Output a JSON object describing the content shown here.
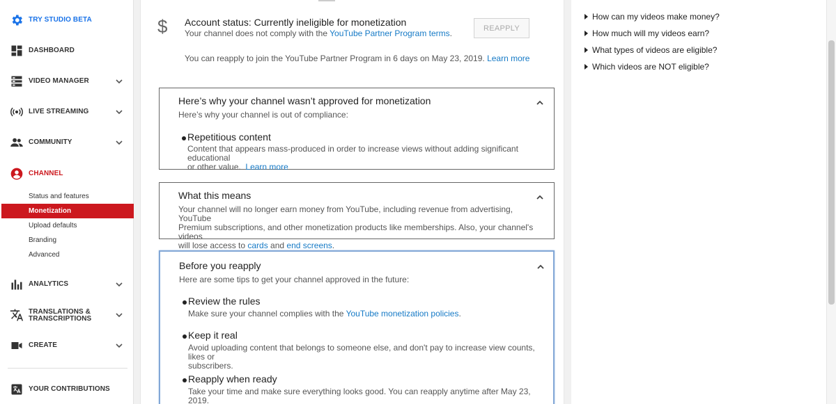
{
  "sidebar": {
    "try_studio": "TRY STUDIO BETA",
    "dashboard": "DASHBOARD",
    "video_manager": "VIDEO MANAGER",
    "live_streaming": "LIVE STREAMING",
    "community": "COMMUNITY",
    "channel": "CHANNEL",
    "channel_items": [
      "Status and features",
      "Monetization",
      "Upload defaults",
      "Branding",
      "Advanced"
    ],
    "analytics": "ANALYTICS",
    "translations_line1": "TRANSLATIONS &",
    "translations_line2": "TRANSCRIPTIONS",
    "create": "CREATE",
    "contributions": "YOUR CONTRIBUTIONS"
  },
  "account": {
    "title": "Account status: Currently ineligible for monetization",
    "sub_prefix": "Your channel does not comply with the ",
    "sub_link": "YouTube Partner Program terms",
    "sub_suffix": ".",
    "reapply_button": "REAPPLY",
    "note_text": "You can reapply to join the YouTube Partner Program in 6 days on May 23, 2019.",
    "note_link": "Learn more"
  },
  "why_card": {
    "title": "Here’s why your channel wasn’t approved for monetization",
    "subtitle": "Here’s why your channel is out of compliance:",
    "item_title": "Repetitious content",
    "item_desc_line1": "Content that appears mass-produced in order to increase views without adding significant educational",
    "item_desc_line2": "or other value.",
    "item_link": "Learn more"
  },
  "means_card": {
    "title": "What this means",
    "line1": "Your channel will no longer earn money from YouTube, including revenue from advertising, YouTube",
    "line2": "Premium subscriptions, and other monetization products like memberships. Also, your channel's videos",
    "line3_prefix": "will lose access to ",
    "link_cards": "cards",
    "and": " and ",
    "link_end_screens": "end screens",
    "suffix": "."
  },
  "before_card": {
    "title": "Before you reapply",
    "subtitle": "Here are some tips to get your channel approved in the future:",
    "tips": [
      {
        "title": "Review the rules",
        "desc_prefix": "Make sure your channel complies with the ",
        "desc_link": "YouTube monetization policies",
        "desc_suffix": "."
      },
      {
        "title": "Keep it real",
        "desc_line1": "Avoid uploading content that belongs to someone else, and don't pay to increase view counts, likes or",
        "desc_line2": "subscribers."
      },
      {
        "title": "Reapply when ready",
        "desc": "Take your time and make sure everything looks good. You can reapply anytime after May 23, 2019."
      }
    ]
  },
  "faq": [
    "How can my videos make money?",
    "How much will my videos earn?",
    "What types of videos are eligible?",
    "Which videos are NOT eligible?"
  ],
  "colors": {
    "accent_red": "#cc181e",
    "link_blue": "#167ac6",
    "studio_blue": "#1a73e8"
  }
}
